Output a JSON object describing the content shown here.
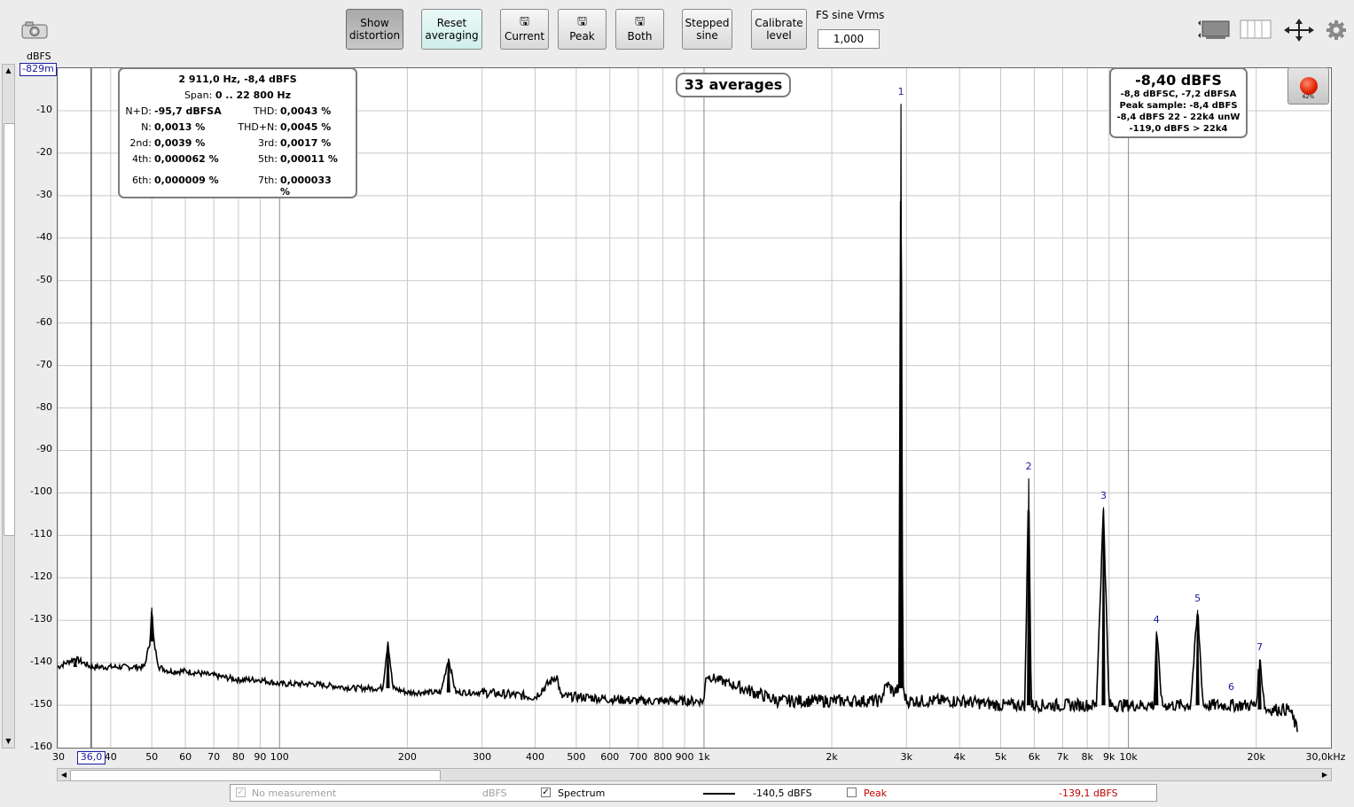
{
  "toolbar": {
    "show_distortion": "Show\ndistortion",
    "reset_averaging": "Reset\naveraging",
    "current": "Current",
    "peak": "Peak",
    "both": "Both",
    "stepped_sine": "Stepped\nsine",
    "calibrate_level": "Calibrate\nlevel",
    "fs_sine_label": "FS sine Vrms",
    "fs_sine_value": "1,000"
  },
  "plot": {
    "y_unit": "dBFS",
    "y_top_readout": "-829m",
    "x_cursor_readout": "36,0",
    "averages": "33 averages"
  },
  "distortion_box": {
    "freq_level": "2 911,0 Hz, -8,4 dBFS",
    "span_label": "Span:",
    "span_value": "0 .. 22 800 Hz",
    "rows": [
      {
        "l1": "N+D:",
        "v1": "-95,7 dBFSA",
        "l2": "THD:",
        "v2": "0,0043 %"
      },
      {
        "l1": "N:",
        "v1": "0,0013 %",
        "l2": "THD+N:",
        "v2": "0,0045 %"
      },
      {
        "l1": "2nd:",
        "v1": "0,0039 %",
        "l2": "3rd:",
        "v2": "0,0017 %"
      },
      {
        "l1": "4th:",
        "v1": "0,000062 %",
        "l2": "5th:",
        "v2": "0,00011 %"
      },
      {
        "l1": "6th:",
        "v1": "0,000009 %",
        "l2": "7th:",
        "v2": "0,000033\n%"
      }
    ]
  },
  "level_box": {
    "main": "-8,40 dBFS",
    "line1": "-8,8 dBFSC, -7,2 dBFSA",
    "line2": "Peak sample: -8,4 dBFS",
    "line3": "-8,4 dBFS 22 - 22k4 unW",
    "line4": "-119,0 dBFS > 22k4"
  },
  "record": {
    "percent": "62%"
  },
  "legend": {
    "no_measurement": "No measurement",
    "no_measurement_unit": "dBFS",
    "spectrum_label": "Spectrum",
    "spectrum_value": "-140,5 dBFS",
    "peak_label": "Peak",
    "peak_value": "-139,1 dBFS"
  },
  "colors": {
    "peak": "#c00000",
    "marker": "#1a1aa0",
    "accent_mint": "#d8f3ef"
  },
  "chart_data": {
    "type": "line",
    "xlabel": "",
    "ylabel": "dBFS",
    "x_scale": "log",
    "xlim": [
      30,
      30000
    ],
    "ylim": [
      -160,
      0
    ],
    "y_ticks": [
      "-10",
      "-20",
      "-30",
      "-40",
      "-50",
      "-60",
      "-70",
      "-80",
      "-90",
      "-100",
      "-110",
      "-120",
      "-130",
      "-140",
      "-150",
      "-160"
    ],
    "x_tick_labels": [
      {
        "v": 30,
        "t": "30"
      },
      {
        "v": 40,
        "t": "40"
      },
      {
        "v": 50,
        "t": "50"
      },
      {
        "v": 60,
        "t": "60"
      },
      {
        "v": 70,
        "t": "70"
      },
      {
        "v": 80,
        "t": "80"
      },
      {
        "v": 90,
        "t": "90"
      },
      {
        "v": 100,
        "t": "100"
      },
      {
        "v": 200,
        "t": "200"
      },
      {
        "v": 300,
        "t": "300"
      },
      {
        "v": 400,
        "t": "400"
      },
      {
        "v": 500,
        "t": "500"
      },
      {
        "v": 600,
        "t": "600"
      },
      {
        "v": 700,
        "t": "700"
      },
      {
        "v": 800,
        "t": "800"
      },
      {
        "v": 900,
        "t": "900"
      },
      {
        "v": 1000,
        "t": "1k"
      },
      {
        "v": 2000,
        "t": "2k"
      },
      {
        "v": 3000,
        "t": "3k"
      },
      {
        "v": 4000,
        "t": "4k"
      },
      {
        "v": 5000,
        "t": "5k"
      },
      {
        "v": 6000,
        "t": "6k"
      },
      {
        "v": 7000,
        "t": "7k"
      },
      {
        "v": 8000,
        "t": "8k"
      },
      {
        "v": 9000,
        "t": "9k"
      },
      {
        "v": 10000,
        "t": "10k"
      },
      {
        "v": 20000,
        "t": "20k"
      },
      {
        "v": 30000,
        "t": "30,0kHz"
      }
    ],
    "series": [
      {
        "x": [
          30,
          33,
          36,
          40,
          45,
          48,
          49.5,
          50,
          50.5,
          52,
          55,
          60,
          70,
          80,
          90,
          100,
          120,
          150,
          175,
          180,
          185,
          200,
          240,
          250,
          260,
          300,
          400,
          450,
          460,
          500,
          700,
          1000,
          1010,
          1500,
          2000,
          2600,
          2700,
          2800,
          2880,
          2911,
          2940,
          3000,
          3500,
          4000,
          5000,
          5700,
          5822,
          5900,
          7000,
          8400,
          8733,
          9000,
          10000,
          11500,
          11644,
          12000,
          14000,
          14555,
          15000,
          17467,
          20000,
          20378,
          21000,
          24000,
          25000
        ],
        "y": [
          -141,
          -139,
          -141,
          -141,
          -141,
          -141,
          -135,
          -127,
          -135,
          -141,
          -142,
          -142,
          -143,
          -144,
          -144,
          -145,
          -145,
          -146,
          -146,
          -135,
          -146,
          -147,
          -147,
          -139,
          -147,
          -147,
          -148,
          -143,
          -148,
          -148,
          -149,
          -149,
          -143,
          -149,
          -149,
          -149,
          -145,
          -147,
          -146,
          -8.4,
          -146,
          -149,
          -149,
          -149,
          -150,
          -150,
          -96.6,
          -150,
          -150,
          -150,
          -103.4,
          -150,
          -150,
          -150,
          -132.6,
          -150,
          -150,
          -127.6,
          -150,
          -150,
          -150,
          -139.2,
          -151,
          -151,
          -156
        ]
      }
    ],
    "harmonic_markers": [
      {
        "label": "1",
        "x": 2911,
        "y": -8.4
      },
      {
        "label": "2",
        "x": 5822,
        "y": -96.6
      },
      {
        "label": "3",
        "x": 8733,
        "y": -103.4
      },
      {
        "label": "4",
        "x": 11644,
        "y": -132.6
      },
      {
        "label": "5",
        "x": 14555,
        "y": -127.6
      },
      {
        "label": "6",
        "x": 17467,
        "y": -148.5
      },
      {
        "label": "7",
        "x": 20378,
        "y": -139.2
      }
    ]
  }
}
